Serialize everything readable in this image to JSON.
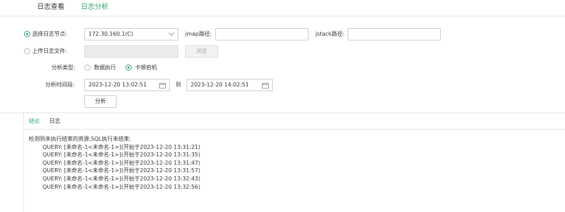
{
  "top_tabs": [
    {
      "label": "日志查看",
      "active": false
    },
    {
      "label": "日志分析",
      "active": true
    }
  ],
  "form": {
    "select_node": {
      "label": "选择日志节点:",
      "value": "172.30.160.1(C)",
      "checked": true
    },
    "jmap": {
      "label": "jmap路径:",
      "value": ""
    },
    "jstack": {
      "label": "jstack路径:",
      "value": ""
    },
    "upload": {
      "label": "上传日志文件:",
      "value": "",
      "checked": false,
      "browse_label": "浏览"
    },
    "analysis_type": {
      "label": "分析类型:",
      "options": [
        {
          "label": "数据执行",
          "checked": false
        },
        {
          "label": "卡顿宕机",
          "checked": true
        }
      ]
    },
    "time_range": {
      "label": "分析时间段:",
      "start": "2023-12-20 13:02:51",
      "separator": "到",
      "end": "2023-12-20 14:02:51"
    },
    "analyze_button": "分析"
  },
  "result": {
    "tabs": [
      {
        "label": "结论",
        "active": true
      },
      {
        "label": "日志",
        "active": false
      }
    ],
    "heading": "检测到未执行结束的资源,SQL执行未结束:",
    "lines": [
      "QUERY: [未命名-1<未命名-1>](开始于2023-12-20 13:31:21)",
      "QUERY: [未命名-1<未命名-1>](开始于2023-12-20 13:31:35)",
      "QUERY: [未命名-1<未命名-1>](开始于2023-12-20 13:31:47)",
      "QUERY: [未命名-1<未命名-1>](开始于2023-12-20 13:31:57)",
      "QUERY: [未命名-1<未命名-1>](开始于2023-12-20 13:32:43)",
      "QUERY: [未命名-1<未命名-1>](开始于2023-12-20 13:32:56)"
    ]
  },
  "colors": {
    "accent": "#2ea36b",
    "border": "#cfcfcf",
    "disabled_bg": "#ececec"
  },
  "icons": {
    "dropdown": "chevron-down-icon",
    "calendar": "calendar-icon",
    "radio": "radio-icon"
  }
}
